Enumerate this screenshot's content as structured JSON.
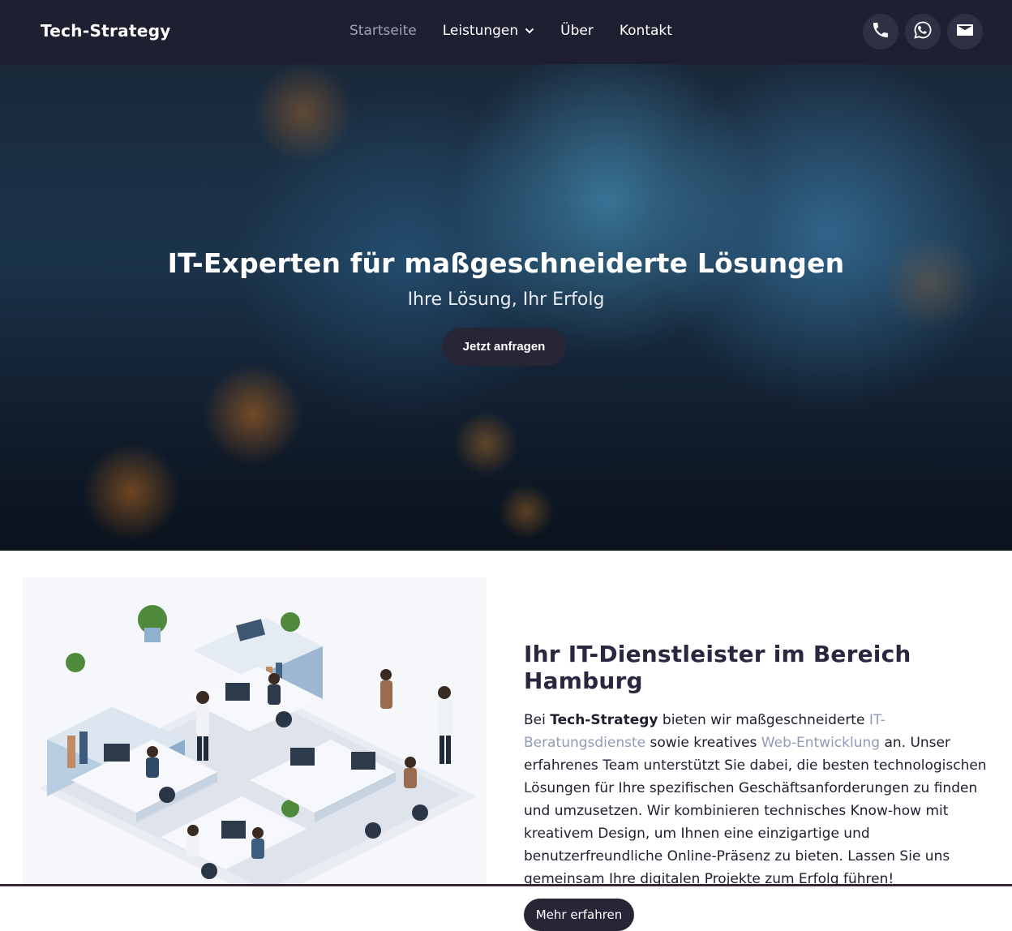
{
  "nav": {
    "brand": "Tech-Strategy",
    "items": [
      {
        "label": "Startseite",
        "active": true
      },
      {
        "label": "Leistungen",
        "has_dropdown": true
      },
      {
        "label": "Über"
      },
      {
        "label": "Kontakt"
      }
    ],
    "social": [
      "phone-icon",
      "whatsapp-icon",
      "mail-icon"
    ]
  },
  "hero": {
    "title": "IT-Experten für maßgeschneiderte Lösungen",
    "subtitle": "Ihre Lösung, Ihr Erfolg",
    "cta": "Jetzt anfragen"
  },
  "about": {
    "heading": "Ihr IT-Dienstleister im Bereich Hamburg",
    "text_1": "Bei ",
    "brand_bold": "Tech-Strategy",
    "text_2": " bieten wir maßgeschneiderte ",
    "link_1": "IT-Beratungsdienste",
    "text_3": " sowie kreatives ",
    "link_2": "Web-Entwicklung",
    "text_4": " an. Unser erfahrenes Team unterstützt Sie dabei, die besten technologischen Lösungen für Ihre spezifischen Geschäftsanforderungen zu finden und umzusetzen. Wir kombinieren technisches Know-how mit kreativem Design, um Ihnen eine einzigartige und benutzerfreundliche Online-Präsenz zu bieten. Lassen Sie uns gemeinsam Ihre digitalen Projekte zum Erfolg führen!",
    "button": "Mehr erfahren"
  },
  "colors": {
    "nav_bg": "#1f1f32",
    "accent_dark": "#262637",
    "link": "#8f9bb7"
  }
}
